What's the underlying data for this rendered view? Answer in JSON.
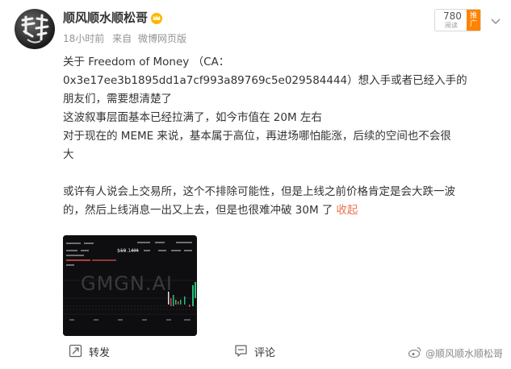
{
  "post": {
    "author": "顺风顺水顺松哥",
    "time": "18小时前",
    "source_prefix": "来自",
    "source": "微博网页版",
    "lines": [
      "关于 Freedom of Money  （CA：",
      "0x3e17ee3b1895dd1a7cf993a89769c5e029584444）想入手或者已经入手的",
      "朋友们，需要想清楚了",
      "这波叙事层面基本已经拉满了，如今市值在 20M 左右",
      "对于现在的 MEME 来说，基本属于高位，再进场哪怕能涨，后续的空间也不会很",
      "大",
      "",
      "或许有人说会上交易所，这个不排除可能性，但是上线之前价格肯定是会大跌一波",
      "的，然后上线消息一出又上去，但是也很难冲破 30M 了"
    ],
    "collapse_label": "收起"
  },
  "rank": {
    "number": "780",
    "sub": "阅读",
    "tag": "推广"
  },
  "media": {
    "watermark_text": "GMGN.AI",
    "price_text": "$19.14M"
  },
  "actions": {
    "repost_label": "转发",
    "comment_label": "评论"
  },
  "watermark": {
    "text": "顺风顺水顺松哥"
  },
  "icons": {
    "vip": "crown-icon",
    "repost": "repost-icon",
    "comment": "comment-icon",
    "more": "chevron-down-icon",
    "weibo": "weibo-logo-icon"
  },
  "colors": {
    "accent": "#eb7350",
    "promo": "#ff8200",
    "meta": "#939393"
  }
}
